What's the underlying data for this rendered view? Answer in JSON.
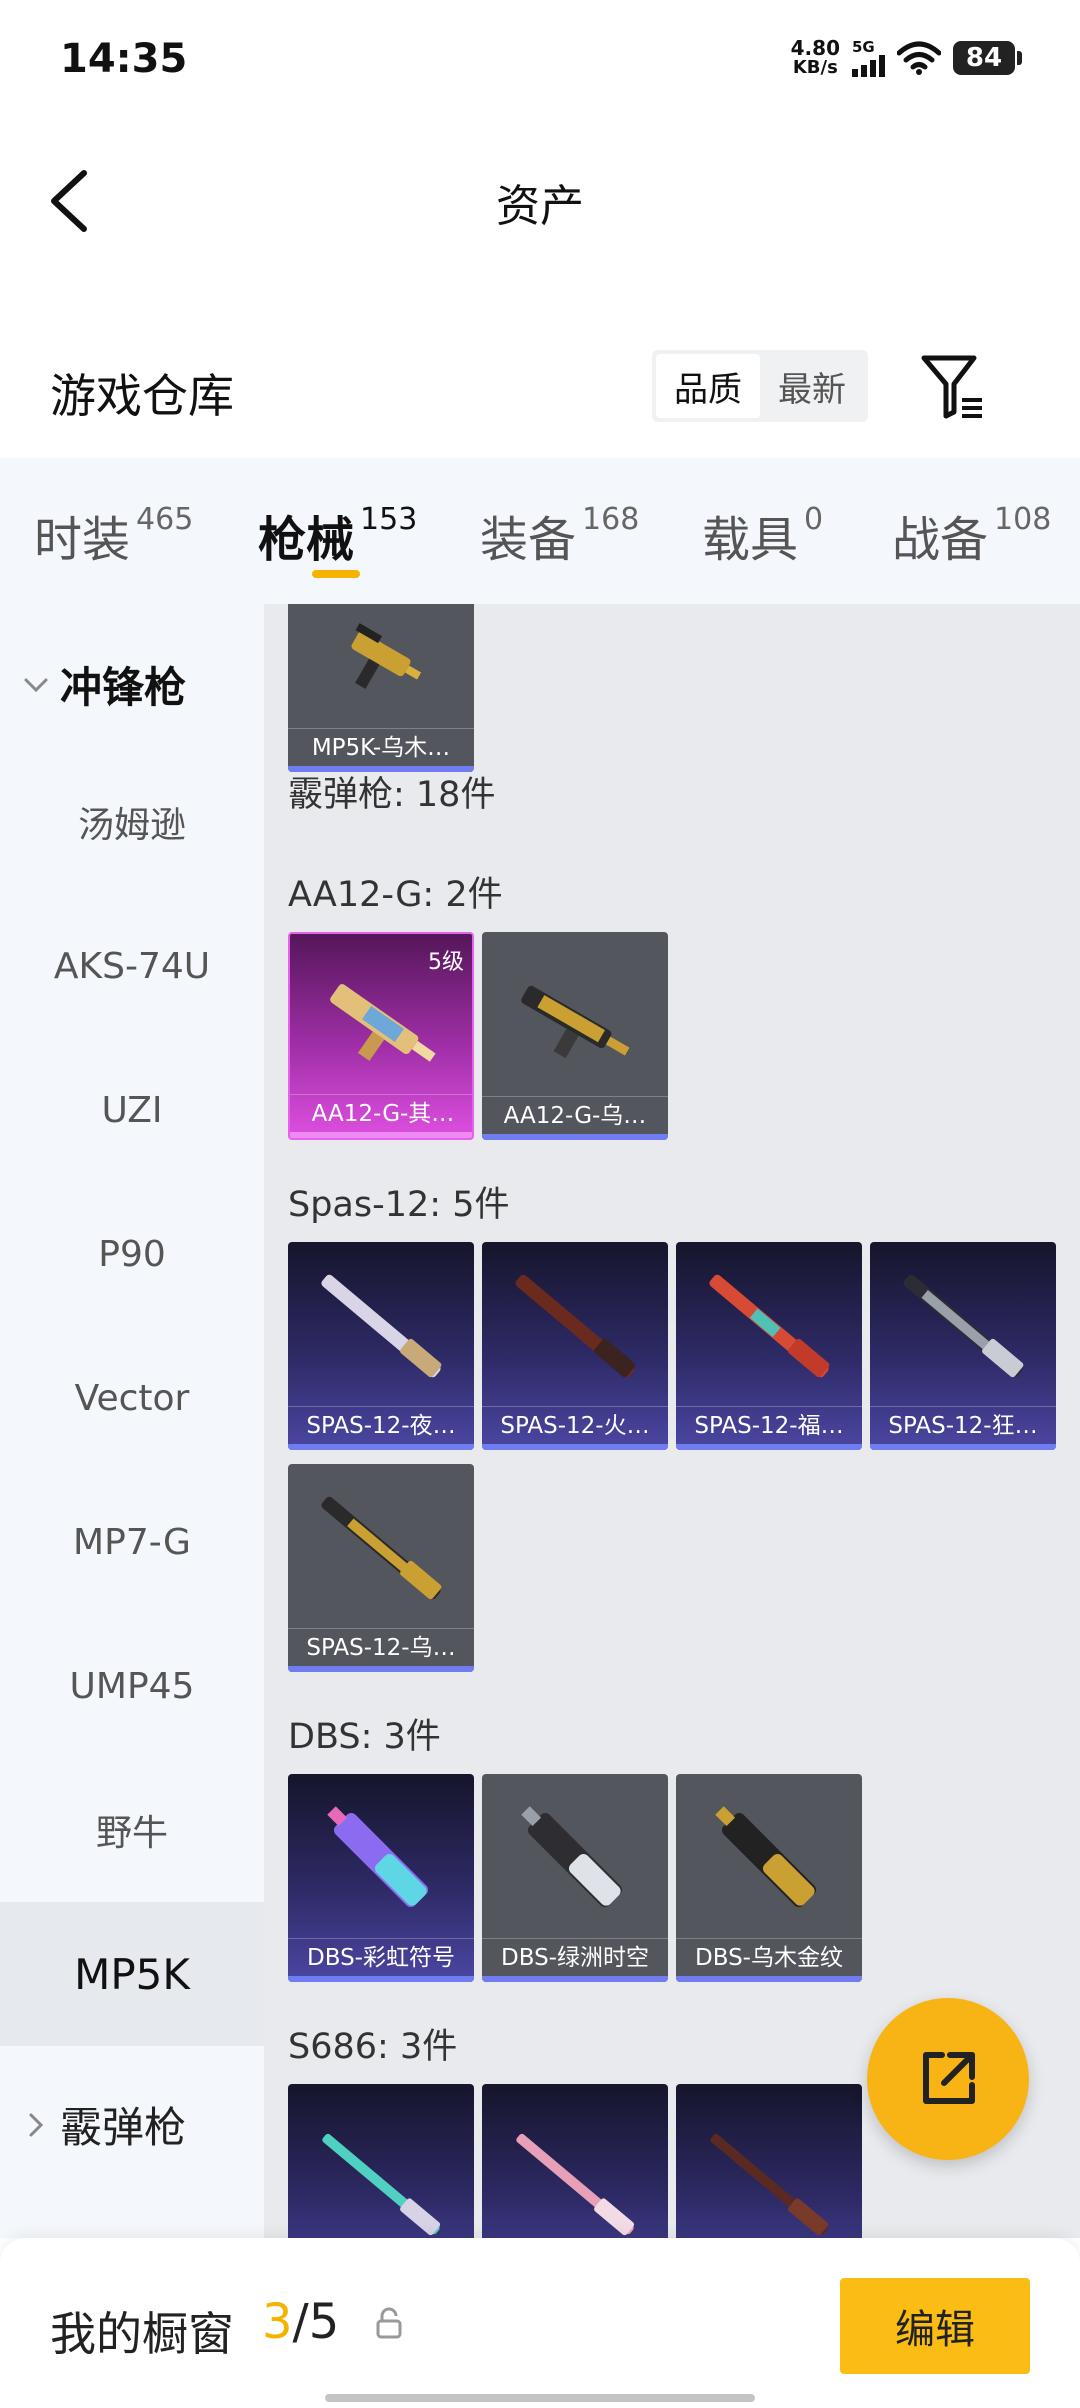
{
  "status": {
    "time": "14:35",
    "net_speed": "4.80",
    "net_unit": "KB/s",
    "network": "5G",
    "battery": "84"
  },
  "header": {
    "title": "资产"
  },
  "warehouse": {
    "title": "游戏仓库",
    "sort_quality": "品质",
    "sort_latest": "最新"
  },
  "tabs": [
    {
      "label": "时装",
      "count": "465"
    },
    {
      "label": "枪械",
      "count": "153"
    },
    {
      "label": "装备",
      "count": "168"
    },
    {
      "label": "载具",
      "count": "0"
    },
    {
      "label": "战备",
      "count": "108"
    }
  ],
  "sidebar": {
    "group_smg": "冲锋枪",
    "items": [
      "汤姆逊",
      "AKS-74U",
      "UZI",
      "P90",
      "Vector",
      "MP7-G",
      "UMP45",
      "野牛",
      "MP5K"
    ],
    "group_shotgun": "霰弹枪"
  },
  "content": {
    "top_card": "MP5K-乌木…",
    "shotgun_header": "霰弹枪: 18件",
    "aa12_header": "AA12-G: 2件",
    "aa12_cards": [
      "AA12-G-其…",
      "AA12-G-乌…"
    ],
    "aa12_level": "5级",
    "spas_header": "Spas-12: 5件",
    "spas_cards": [
      "SPAS-12-夜…",
      "SPAS-12-火…",
      "SPAS-12-福…",
      "SPAS-12-狂…",
      "SPAS-12-乌…"
    ],
    "dbs_header": "DBS: 3件",
    "dbs_cards": [
      "DBS-彩虹符号",
      "DBS-绿洲时空",
      "DBS-乌木金纹"
    ],
    "s686_header": "S686: 3件"
  },
  "bottom": {
    "showcase_label": "我的橱窗",
    "showcase_current": "3",
    "showcase_total": "/5",
    "edit_label": "编辑"
  },
  "colors": {
    "accent": "#f5b300",
    "card_gray": "#54565e",
    "card_purple": "#2e2a66",
    "card_pink": "#a02fa7",
    "bar_blue": "#6f7df0"
  }
}
